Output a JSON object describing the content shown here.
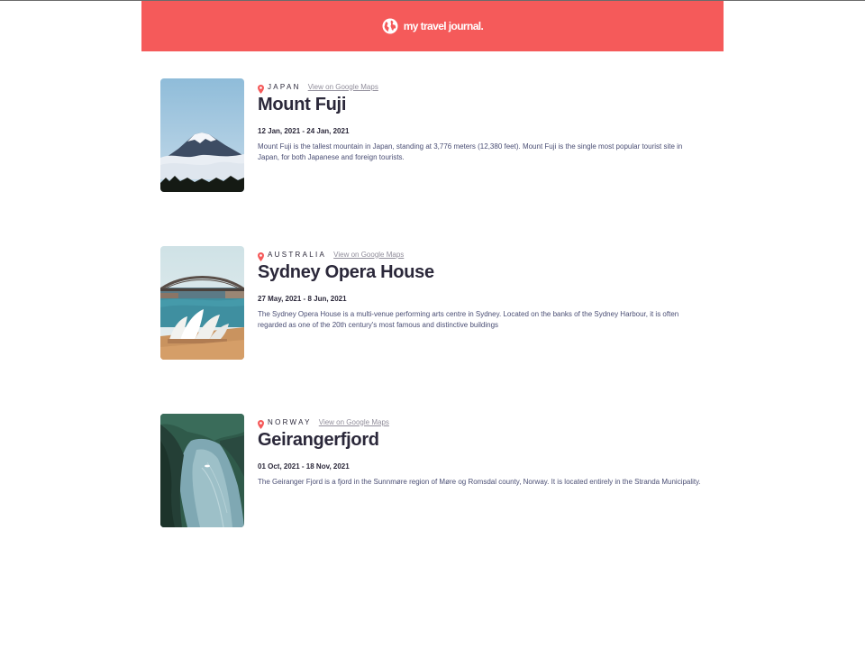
{
  "header": {
    "brand": "my travel journal.",
    "icon": "globe-icon",
    "color": "#f55a5a"
  },
  "entries": [
    {
      "country": "JAPAN",
      "maps_link": "View on Google Maps",
      "title": "Mount Fuji",
      "dates": "12 Jan, 2021 - 24 Jan, 2021",
      "description": "Mount Fuji is the tallest mountain in Japan, standing at 3,776 meters (12,380 feet). Mount Fuji is the single most popular tourist site in Japan, for both Japanese and foreign tourists.",
      "image": "mount-fuji-photo"
    },
    {
      "country": "AUSTRALIA",
      "maps_link": "View on Google Maps",
      "title": "Sydney Opera House",
      "dates": "27 May, 2021 - 8 Jun, 2021",
      "description": "The Sydney Opera House is a multi-venue performing arts centre in Sydney. Located on the banks of the Sydney Harbour, it is often regarded as one of the 20th century's most famous and distinctive buildings",
      "image": "sydney-opera-house-photo"
    },
    {
      "country": "NORWAY",
      "maps_link": "View on Google Maps",
      "title": "Geirangerfjord",
      "dates": "01 Oct, 2021 - 18 Nov, 2021",
      "description": "The Geiranger Fjord is a fjord in the Sunnmøre region of Møre og Romsdal county, Norway. It is located entirely in the Stranda Municipality.",
      "image": "geirangerfjord-photo"
    }
  ],
  "colors": {
    "pin": "#f55a5a",
    "title": "#2b283a",
    "link": "#918e9b"
  }
}
